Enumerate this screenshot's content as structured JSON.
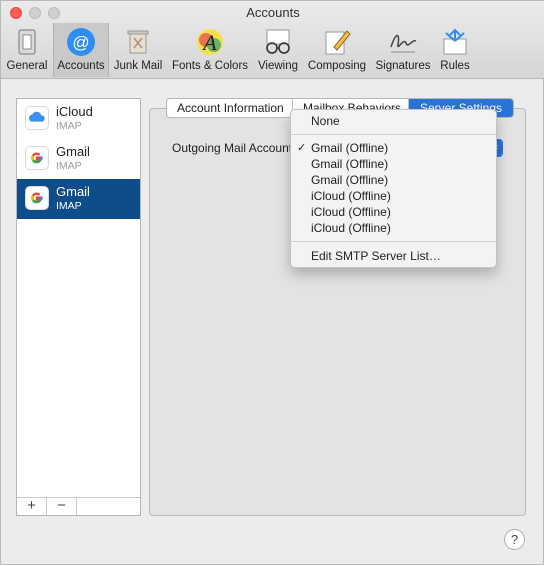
{
  "window": {
    "title": "Accounts"
  },
  "toolbar": {
    "items": [
      {
        "label": "General",
        "icon": "general-icon"
      },
      {
        "label": "Accounts",
        "icon": "at-icon"
      },
      {
        "label": "Junk Mail",
        "icon": "trash-icon"
      },
      {
        "label": "Fonts & Colors",
        "icon": "fonts-icon"
      },
      {
        "label": "Viewing",
        "icon": "glasses-icon"
      },
      {
        "label": "Composing",
        "icon": "pencil-icon"
      },
      {
        "label": "Signatures",
        "icon": "signature-icon"
      },
      {
        "label": "Rules",
        "icon": "rules-icon"
      }
    ],
    "selected": "Accounts"
  },
  "accounts": [
    {
      "name": "iCloud",
      "type": "IMAP",
      "icon": "icloud-icon"
    },
    {
      "name": "Gmail",
      "type": "IMAP",
      "icon": "google-icon"
    },
    {
      "name": "Gmail",
      "type": "IMAP",
      "icon": "google-icon",
      "selected": true
    }
  ],
  "list_footer": {
    "add": "+",
    "remove": "−"
  },
  "tabs": [
    {
      "label": "Account Information"
    },
    {
      "label": "Mailbox Behaviors"
    },
    {
      "label": "Server Settings",
      "selected": true
    }
  ],
  "server_settings": {
    "outgoing_label": "Outgoing Mail Account"
  },
  "outgoing_menu": {
    "top": "None",
    "items": [
      {
        "label": "Gmail (Offline)",
        "checked": true
      },
      {
        "label": "Gmail (Offline)"
      },
      {
        "label": "Gmail (Offline)"
      },
      {
        "label": "iCloud (Offline)"
      },
      {
        "label": "iCloud (Offline)"
      },
      {
        "label": "iCloud (Offline)"
      }
    ],
    "edit": "Edit SMTP Server List…",
    "check_mark": "✓"
  },
  "help": "?",
  "colors": {
    "selection": "#0f4c8a",
    "accent": "#2a74d8"
  }
}
